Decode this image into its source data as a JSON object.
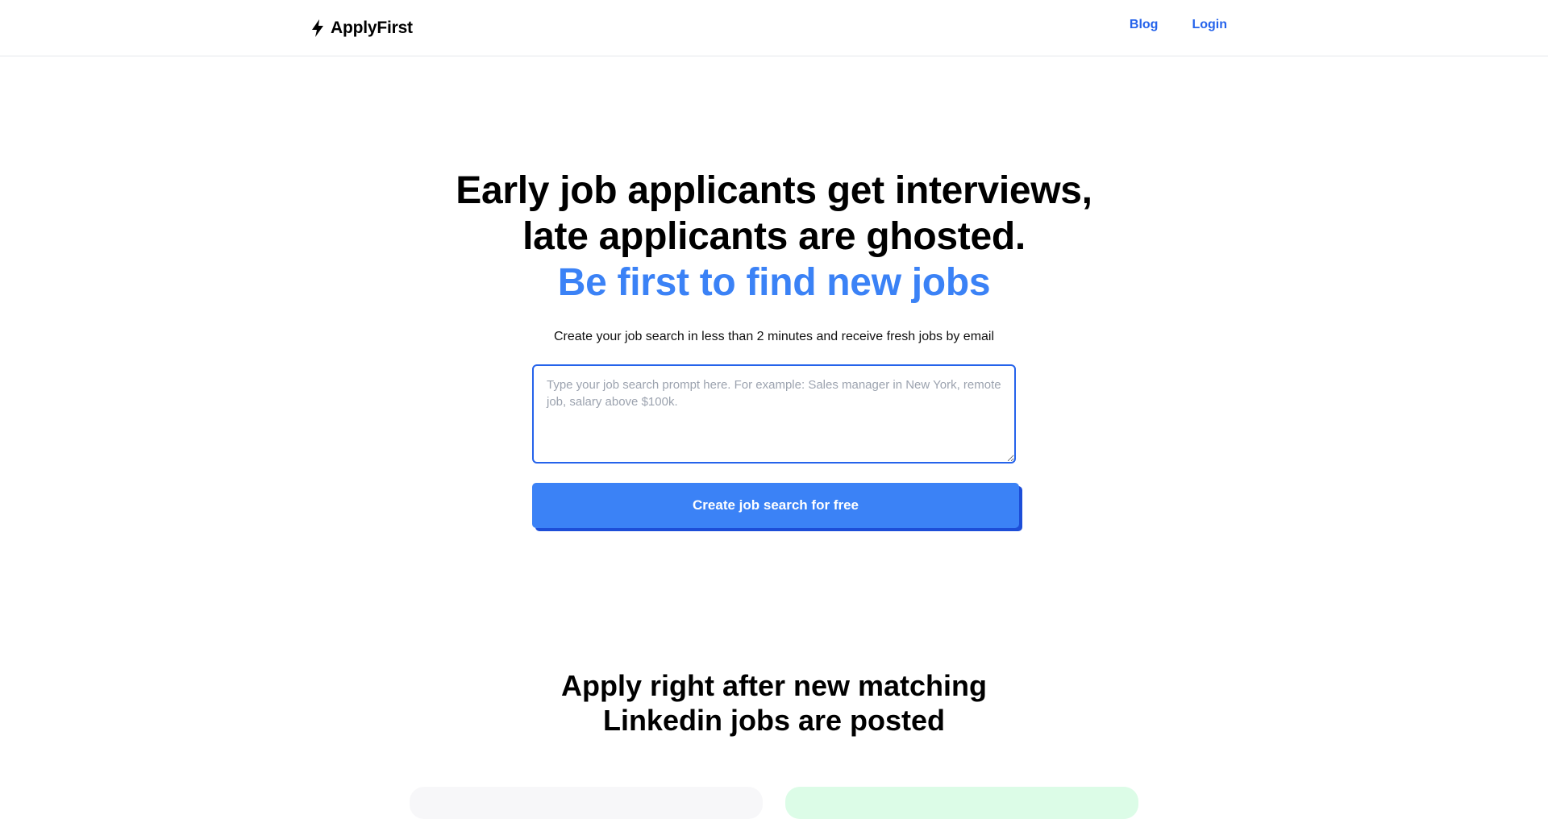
{
  "nav": {
    "brand": "ApplyFirst",
    "brand_icon": "bolt-icon",
    "links": [
      "Blog",
      "Login"
    ],
    "link_color": "#2563eb"
  },
  "hero": {
    "line1": "Early job applicants get interviews,",
    "line2": "late applicants are ghosted.",
    "accent": "Be first to find new jobs",
    "accent_color": "#3b82f6",
    "subtitle": "Create your job search in less than 2 minutes and receive fresh jobs by email"
  },
  "search": {
    "placeholder": "Type your job search prompt here. For example: Sales manager in New York, remote job, salary above $100k.",
    "value": "",
    "button_label": "Create job search for free",
    "button_color": "#3b82f6"
  },
  "section": {
    "title_line1": "Apply right after new matching",
    "title_line2": "Linkedin jobs are posted"
  }
}
